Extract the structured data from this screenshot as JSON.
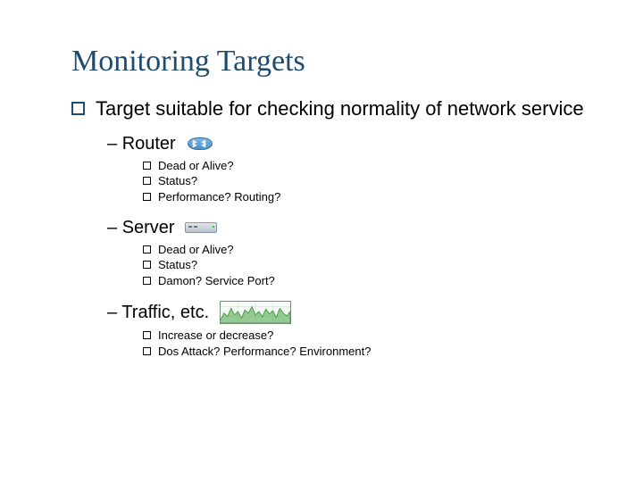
{
  "title": "Monitoring Targets",
  "main": {
    "lead": "Target suitable for checking normality of network service",
    "sections": [
      {
        "heading": "Router",
        "items": [
          "Dead or Alive?",
          "Status?",
          "Performance? Routing?"
        ]
      },
      {
        "heading": "Server",
        "items": [
          "Dead or Alive?",
          "Status?",
          "Damon? Service Port?"
        ]
      },
      {
        "heading": "Traffic, etc.",
        "items": [
          "Increase or decrease?",
          "Dos Attack? Performance? Environment?"
        ]
      }
    ]
  }
}
